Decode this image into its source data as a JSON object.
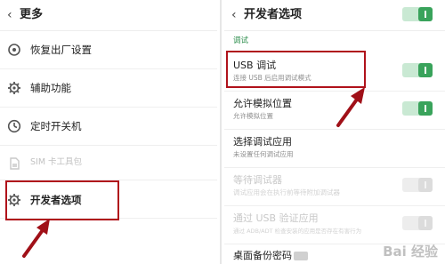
{
  "left": {
    "title": "更多",
    "items": [
      {
        "label": "恢复出厂设置",
        "icon": "restore-icon",
        "enabled": true
      },
      {
        "label": "辅助功能",
        "icon": "gear-icon",
        "enabled": true
      },
      {
        "label": "定时开关机",
        "icon": "clock-icon",
        "enabled": true
      },
      {
        "label": "SIM 卡工具包",
        "icon": "sim-card-icon",
        "enabled": false
      },
      {
        "label": "开发者选项",
        "icon": "gear-icon",
        "enabled": true
      }
    ]
  },
  "right": {
    "title": "开发者选项",
    "master_switch_on": true,
    "section": "调试",
    "items": [
      {
        "title": "USB 调试",
        "subtitle": "连接 USB 后启用调试模式",
        "switch": "on",
        "enabled": true
      },
      {
        "title": "允许模拟位置",
        "subtitle": "允许模拟位置",
        "switch": "on",
        "enabled": true
      },
      {
        "title": "选择调试应用",
        "subtitle": "未设置任何调试应用",
        "switch": "none",
        "enabled": true
      },
      {
        "title": "等待调试器",
        "subtitle": "调试应用会在执行前等待附加调试器",
        "switch": "off",
        "enabled": false
      },
      {
        "title": "通过 USB 验证应用",
        "subtitle": "通过 ADB/ADT 检查安装的应用是否存在有害行为",
        "switch": "off",
        "enabled": false
      },
      {
        "title": "桌面备份密码",
        "subtitle": "",
        "switch": "none",
        "enabled": true
      }
    ]
  },
  "watermark": "Bai 经验",
  "colors": {
    "accent": "#39a35b",
    "highlight": "#b0121b",
    "section": "#2f8f4e"
  }
}
